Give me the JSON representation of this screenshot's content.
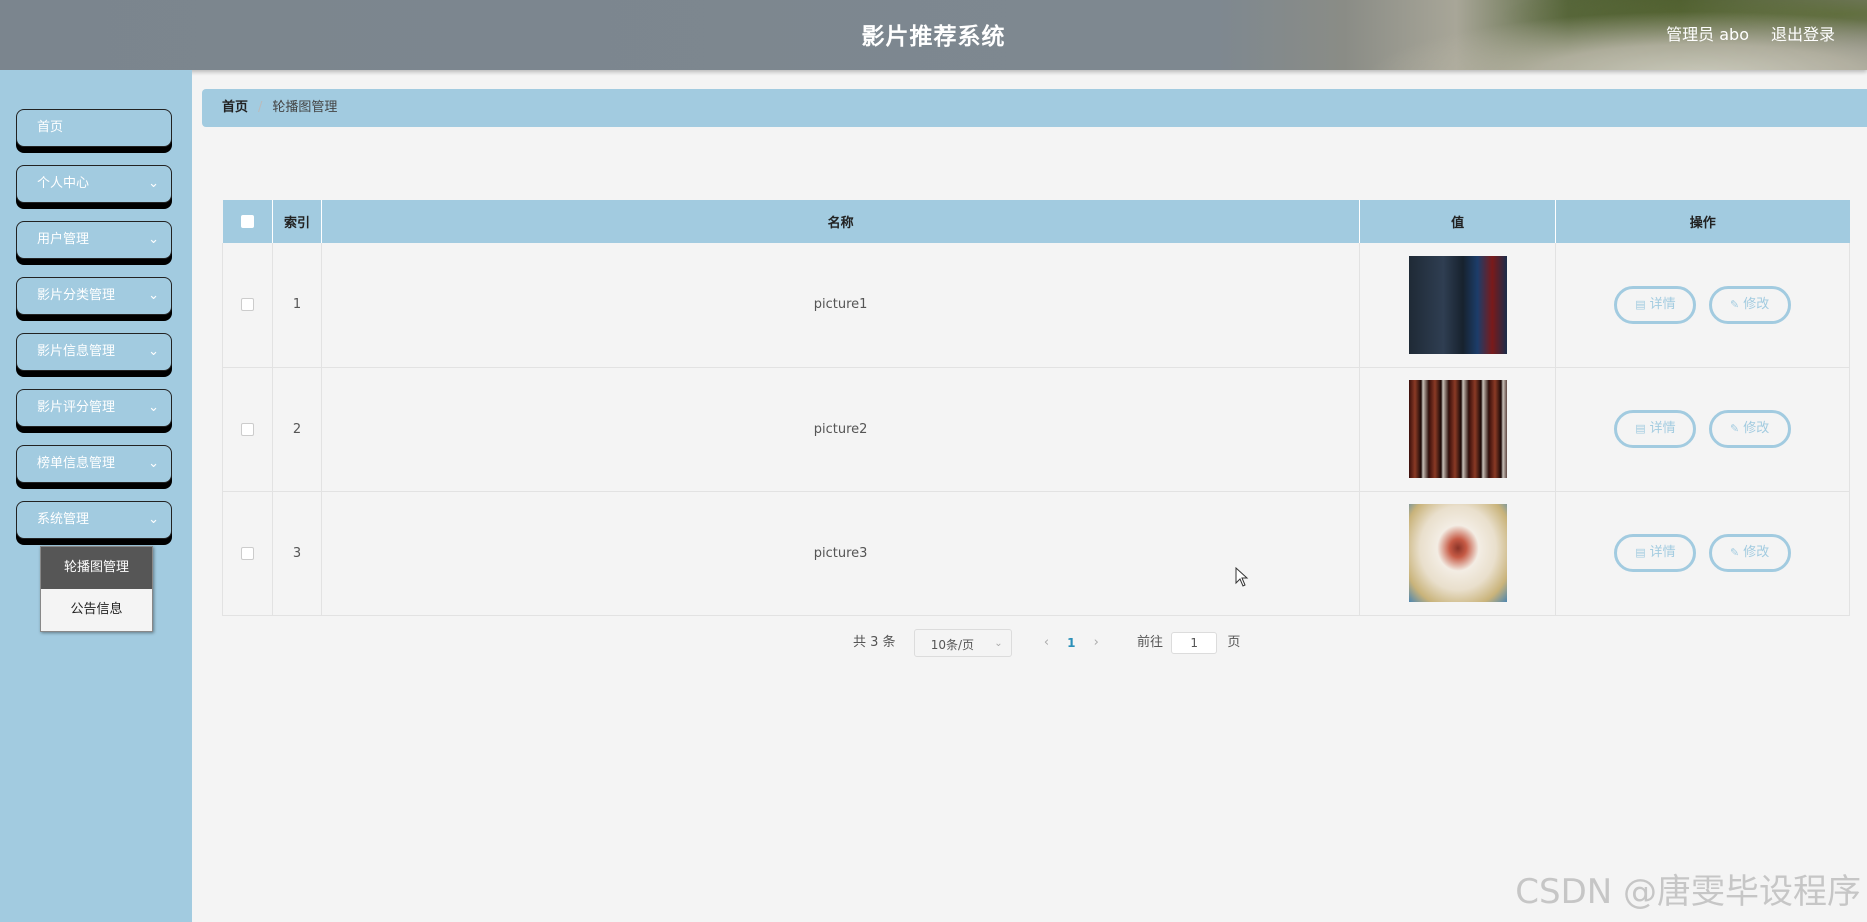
{
  "header": {
    "title": "影片推荐系统",
    "admin_label": "管理员 abo",
    "logout_label": "退出登录"
  },
  "sidebar": {
    "items": [
      {
        "label": "首页",
        "has_submenu": false
      },
      {
        "label": "个人中心",
        "has_submenu": true
      },
      {
        "label": "用户管理",
        "has_submenu": true
      },
      {
        "label": "影片分类管理",
        "has_submenu": true
      },
      {
        "label": "影片信息管理",
        "has_submenu": true
      },
      {
        "label": "影片评分管理",
        "has_submenu": true
      },
      {
        "label": "榜单信息管理",
        "has_submenu": true
      },
      {
        "label": "系统管理",
        "has_submenu": true
      }
    ],
    "submenu": [
      {
        "label": "轮播图管理",
        "active": true
      },
      {
        "label": "公告信息",
        "active": false
      }
    ]
  },
  "breadcrumb": {
    "home": "首页",
    "separator": "/",
    "current": "轮播图管理"
  },
  "table": {
    "headers": [
      "索引",
      "名称",
      "值",
      "操作"
    ],
    "rows": [
      {
        "index": "1",
        "name": "picture1",
        "thumb": "t1"
      },
      {
        "index": "2",
        "name": "picture2",
        "thumb": "t2"
      },
      {
        "index": "3",
        "name": "picture3",
        "thumb": "t3"
      }
    ],
    "detail_label": "详情",
    "edit_label": "修改"
  },
  "pagination": {
    "total_label": "共 3 条",
    "page_size": "10条/页",
    "current_page": "1",
    "goto_label": "前往",
    "goto_value": "1",
    "page_suffix": "页"
  },
  "watermark": "CSDN @唐雯毕设程序",
  "colors": {
    "accent": "#a2cbe0",
    "submenu_active": "#565656",
    "page_active": "#2a8fb8"
  }
}
